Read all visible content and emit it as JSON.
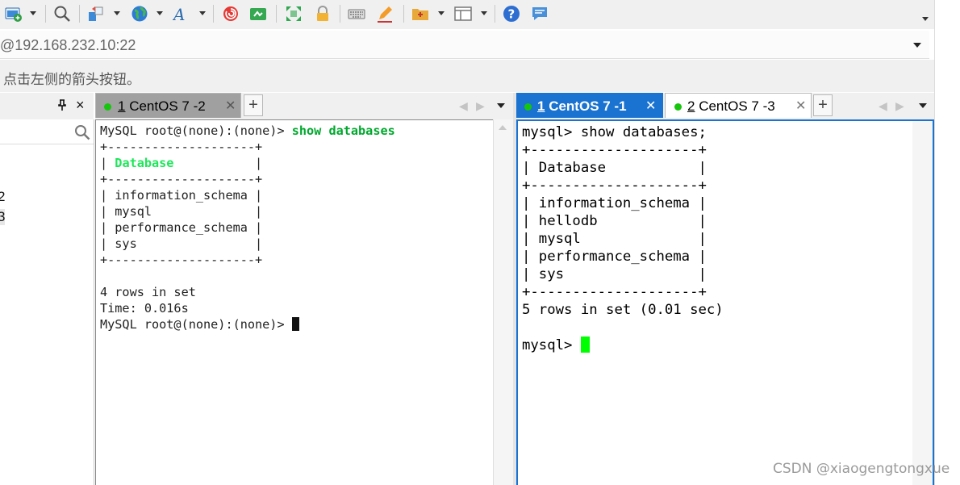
{
  "toolbar": {
    "icons": [
      "new-session-icon",
      "search-icon",
      "transfer-icon",
      "globe-icon",
      "font-icon",
      "swirl-icon",
      "xftp-icon",
      "fullscreen-icon",
      "lock-icon",
      "keyboard-icon",
      "pen-icon",
      "folder-icon",
      "layout-icon",
      "help-icon",
      "chat-icon"
    ]
  },
  "address": {
    "text": "@192.168.232.10:22"
  },
  "hint": {
    "text": "点击左侧的箭头按钮。"
  },
  "sidebar": {
    "close_glyph": "×",
    "cut_chars": [
      "2",
      "3"
    ]
  },
  "left_pane": {
    "tab": {
      "number": "1",
      "label": " CentOS 7 -2"
    },
    "terminal": {
      "prompt": "MySQL root@(none):(none)> ",
      "command": "show databases",
      "border": "+--------------------+",
      "header_pre": "| ",
      "header": "Database",
      "header_post": "           |",
      "rows": [
        "| information_schema |",
        "| mysql              |",
        "| performance_schema |",
        "| sys                |"
      ],
      "summary": "4 rows in set",
      "time": "Time: 0.016s",
      "final_prompt": "MySQL root@(none):(none)> "
    }
  },
  "right_pane": {
    "tabs": [
      {
        "number": "1",
        "label": " CentOS 7 -1",
        "active": true
      },
      {
        "number": "2",
        "label": " CentOS 7 -3",
        "active": false
      }
    ],
    "terminal": {
      "command_line": "mysql> show databases;",
      "border": "+--------------------+",
      "header": "| Database           |",
      "rows": [
        "| information_schema |",
        "| hellodb            |",
        "| mysql              |",
        "| performance_schema |",
        "| sys                |"
      ],
      "summary": "5 rows in set (0.01 sec)",
      "final_prompt": "mysql> "
    }
  },
  "tab_controls": {
    "plus": "+",
    "prev": "◀",
    "next": "▶"
  },
  "watermark": "CSDN @xiaogengtongxue",
  "colors": {
    "accent": "#1a73d0",
    "status_green": "#16c60c",
    "cursor_green": "#00ff00"
  }
}
